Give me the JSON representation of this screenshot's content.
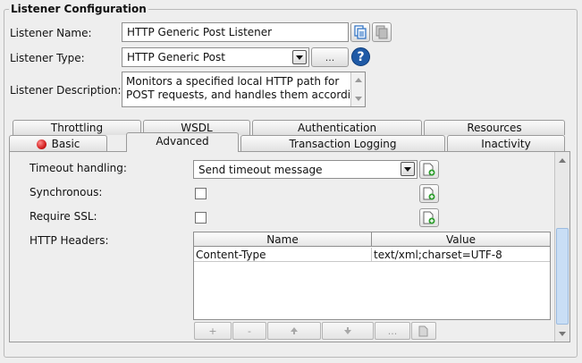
{
  "section_title": "Listener Configuration",
  "listener_name": {
    "label": "Listener Name:",
    "value": "HTTP Generic Post Listener",
    "copy_icon": "copy-icon",
    "paste_icon": "paste-icon"
  },
  "listener_type": {
    "label": "Listener Type:",
    "value": "HTTP Generic Post",
    "browse_label": "...",
    "help_label": "?",
    "help_color": "#1f5aa6"
  },
  "listener_description": {
    "label": "Listener Description:",
    "line1": "Monitors a specified local HTTP path for",
    "line2": "POST requests, and handles them according"
  },
  "tabs_row1": [
    {
      "label": "Throttling"
    },
    {
      "label": "WSDL"
    },
    {
      "label": "Authentication"
    },
    {
      "label": "Resources"
    }
  ],
  "tabs_row2": [
    {
      "label": "Basic",
      "status_color": "#d21e1e"
    },
    {
      "label": "Advanced",
      "active": true
    },
    {
      "label": "Transaction Logging"
    },
    {
      "label": "Inactivity"
    }
  ],
  "advanced": {
    "timeout_handling": {
      "label": "Timeout handling:",
      "value": "Send timeout message"
    },
    "synchronous": {
      "label": "Synchronous:",
      "checked": false
    },
    "require_ssl": {
      "label": "Require SSL:",
      "checked": false
    },
    "http_headers": {
      "label": "HTTP Headers:",
      "columns": [
        "Name",
        "Value"
      ],
      "rows": [
        [
          "Content-Type",
          "text/xml;charset=UTF-8"
        ]
      ],
      "buttons": {
        "add": "+",
        "remove": "-",
        "move_up_icon": "move-up-icon",
        "move_down_icon": "move-down-icon",
        "edit": "...",
        "edit_doc_icon": "document-icon"
      }
    }
  },
  "colors": {
    "add_icon_green": "#2e9e2e",
    "scroll_thumb": "#c9def5"
  }
}
